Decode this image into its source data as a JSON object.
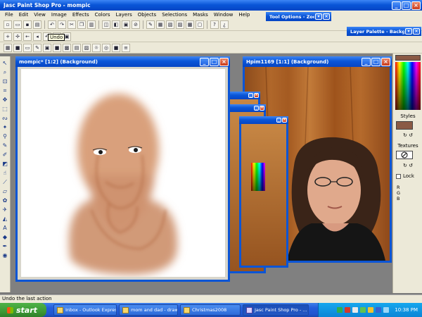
{
  "app": {
    "title": "Jasc Paint Shop Pro - mompic"
  },
  "menu": [
    "File",
    "Edit",
    "View",
    "Image",
    "Effects",
    "Colors",
    "Layers",
    "Objects",
    "Selections",
    "Masks",
    "Window",
    "Help"
  ],
  "tooltip": "Undo",
  "tool_options": {
    "title": "Tool Options - Zoom"
  },
  "layer_palette": {
    "title": "Layer Palette - Backg"
  },
  "windows": {
    "mompic": {
      "title": "mompic* [1:2] (Background)"
    },
    "hpim": {
      "title": "Hpim1169 [1:1] (Background)"
    }
  },
  "side_panel": {
    "styles_label": "Styles",
    "textures_label": "Textures",
    "lock_label": "Lock",
    "rgb": [
      "R",
      "G",
      "B"
    ],
    "fg_color": "#8a5a45"
  },
  "status": {
    "text": "Undo the last action"
  },
  "taskbar": {
    "start": "start",
    "tasks": [
      {
        "label": "Inbox - Outlook Express",
        "active": false
      },
      {
        "label": "mom and dad - drawi...",
        "active": false
      },
      {
        "label": "Christmas2008",
        "active": false
      },
      {
        "label": "Jasc Paint Shop Pro - ...",
        "active": true
      }
    ],
    "clock": "10:38 PM"
  }
}
